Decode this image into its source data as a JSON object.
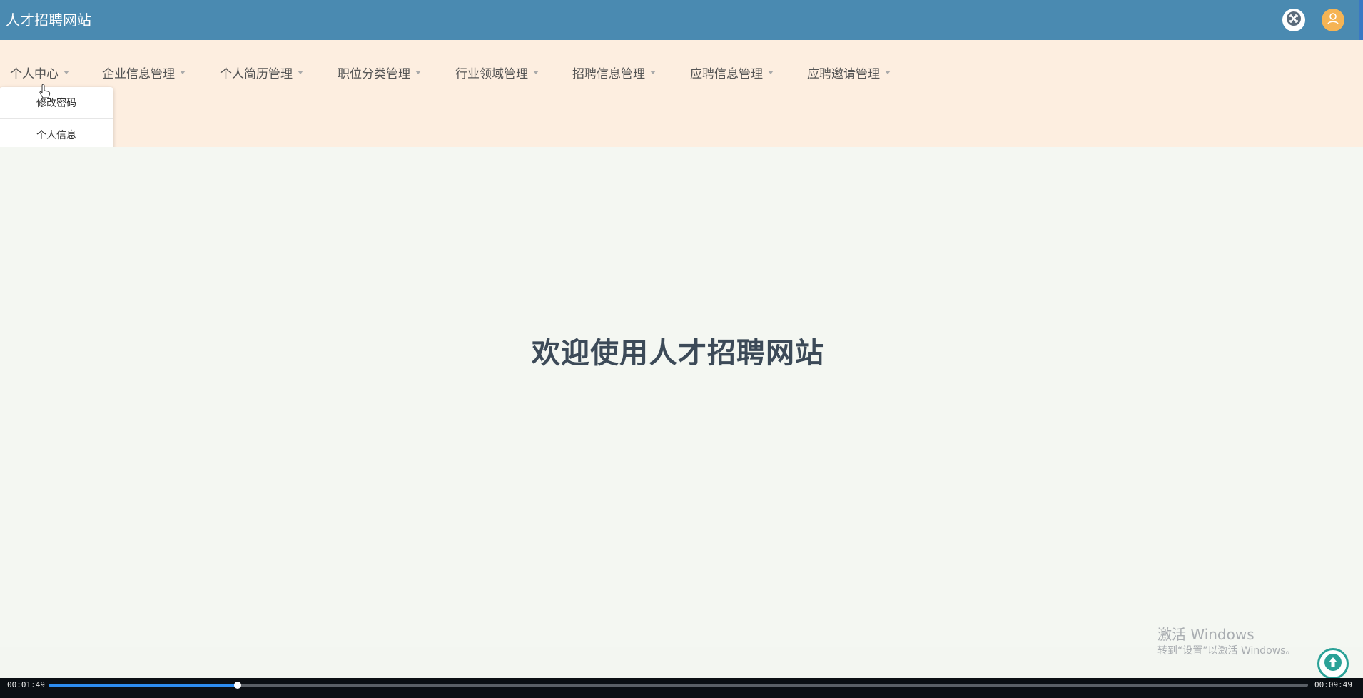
{
  "app": {
    "title": "人才招聘网站"
  },
  "nav": {
    "items": [
      {
        "label": "个人中心"
      },
      {
        "label": "企业信息管理"
      },
      {
        "label": "个人简历管理"
      },
      {
        "label": "职位分类管理"
      },
      {
        "label": "行业领域管理"
      },
      {
        "label": "招聘信息管理"
      },
      {
        "label": "应聘信息管理"
      },
      {
        "label": "应聘邀请管理"
      }
    ],
    "dropdown": [
      {
        "label": "修改密码"
      },
      {
        "label": "个人信息"
      }
    ]
  },
  "main": {
    "welcome": "欢迎使用人才招聘网站"
  },
  "watermark": {
    "line1": "激活 Windows",
    "line2": "转到“设置”以激活 Windows。"
  },
  "player": {
    "current_time": "00:01:49",
    "total_time": "00:09:49",
    "progress_fraction": 0.15
  },
  "icons": {
    "topbar": [
      "fullscreen-icon",
      "avatar-icon"
    ],
    "back_to_top": "arrow-up-icon"
  },
  "colors": {
    "topbar": "#4a8ab1",
    "navbar": "#fdeee0",
    "main_bg": "#f4f7f2",
    "avatar": "#f5b454",
    "back_to_top": "#2aa197",
    "progress": "#2d8cf0"
  }
}
